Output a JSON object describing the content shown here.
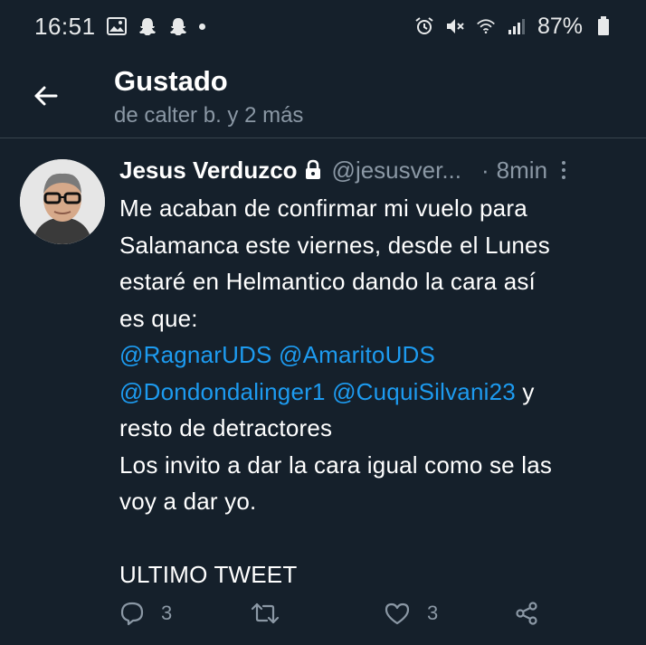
{
  "status_bar": {
    "time": "16:51",
    "battery": "87%",
    "left_icons": [
      "gallery-icon",
      "snapchat-icon",
      "snapchat-icon",
      "dot-icon"
    ],
    "right_icons": [
      "alarm-icon",
      "mute-icon",
      "wifi-icon",
      "signal-icon",
      "battery-icon"
    ]
  },
  "header": {
    "title": "Gustado",
    "subtitle": "de calter b. y 2 más"
  },
  "tweet": {
    "author_name": "Jesus Verduzco",
    "handle": "@jesusver...",
    "separator": "·",
    "time": "8min",
    "body": {
      "line1": "Me acaban de confirmar mi vuelo para",
      "line2": "Salamanca este viernes, desde el Lunes",
      "line3": "estaré en Helmantico dando la cara así",
      "line4": "es que:",
      "mention1": "@RagnarUDS",
      "mention2": "@AmaritoUDS",
      "mention3": "@Dondondalinger1",
      "mention4": "@CuquiSilvani23",
      "after_mentions": "y",
      "line7": "resto de detractores",
      "line8": "Los invito a dar la cara igual como se las",
      "line9": "voy a dar yo.",
      "line11": "ULTIMO TWEET"
    },
    "actions": {
      "reply_count": "3",
      "retweet_count": "",
      "like_count": "3"
    }
  },
  "colors": {
    "background": "#15202b",
    "accent": "#1d9bf0",
    "muted": "#8b98a5",
    "divider": "#38444d"
  }
}
